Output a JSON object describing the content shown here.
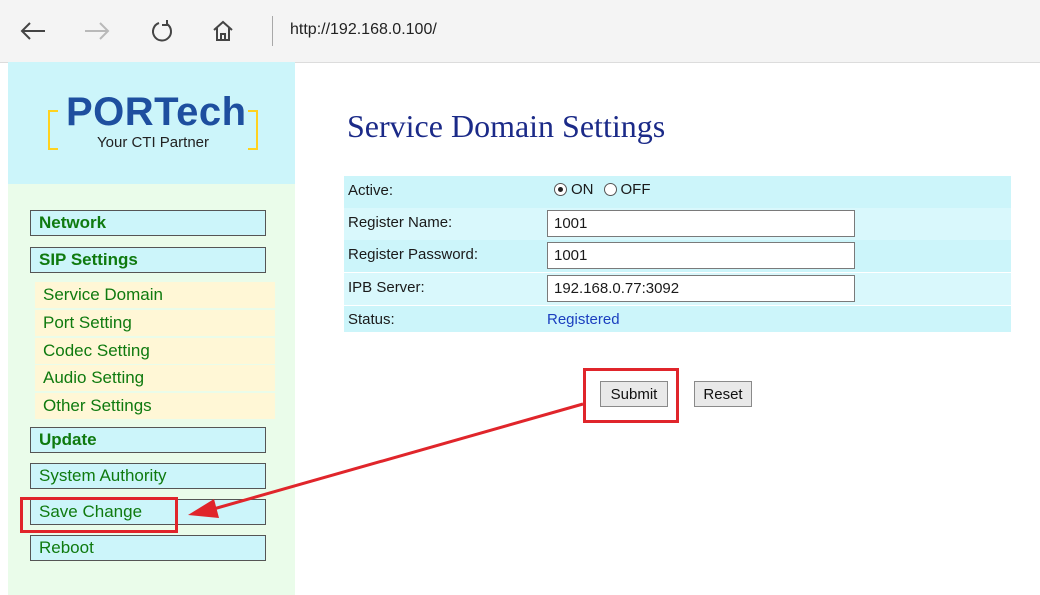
{
  "browser": {
    "url": "http://192.168.0.100/",
    "icons": [
      "back-arrow-icon",
      "forward-arrow-icon",
      "refresh-icon",
      "home-icon"
    ]
  },
  "logo": {
    "main": "PORTech",
    "tagline": "Your CTI Partner"
  },
  "sidebar": {
    "items": [
      {
        "label": "Network"
      },
      {
        "label": "SIP Settings"
      },
      {
        "label": "Service Domain"
      },
      {
        "label": "Port Setting"
      },
      {
        "label": "Codec Setting"
      },
      {
        "label": "Audio Setting"
      },
      {
        "label": "Other Settings"
      },
      {
        "label": "Update"
      },
      {
        "label": "System Authority"
      },
      {
        "label": "Save Change"
      },
      {
        "label": "Reboot"
      }
    ]
  },
  "main": {
    "title": "Service Domain Settings",
    "fields": {
      "active_label": "Active:",
      "active_on": "ON",
      "active_off": "OFF",
      "active_selected": "ON",
      "register_name_label": "Register Name:",
      "register_name_value": "1001",
      "register_password_label": "Register Password:",
      "register_password_value": "1001",
      "ipb_server_label": "IPB Server:",
      "ipb_server_value": "192.168.0.77:3092",
      "status_label": "Status:",
      "status_value": "Registered"
    },
    "buttons": {
      "submit": "Submit",
      "reset": "Reset"
    }
  },
  "colors": {
    "highlight": "#e0252b",
    "title": "#1b2a88",
    "menu_text": "#0f7a0f",
    "status_text": "#1a3fbf"
  }
}
